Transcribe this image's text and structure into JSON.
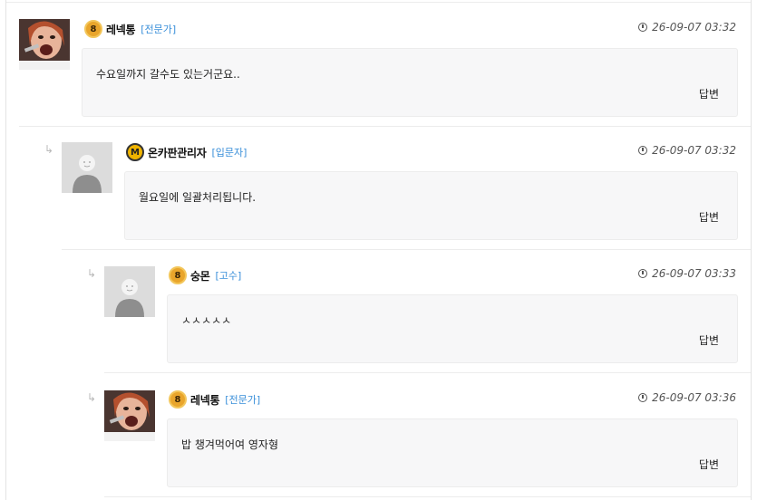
{
  "comments": [
    {
      "author": "레넥통",
      "badge": "8",
      "level": "[전문가]",
      "time": "26-09-07 03:32",
      "text": "수요일까지 갈수도 있는거군요..",
      "reply": "답변",
      "avatar": "photo-avatar"
    },
    {
      "author": "온카판관리자",
      "badge": "M",
      "level": "[입문자]",
      "time": "26-09-07 03:32",
      "text": "월요일에 일괄처리됩니다.",
      "reply": "답변",
      "avatar": "default-avatar"
    },
    {
      "author": "숭몬",
      "badge": "8",
      "level": "[고수]",
      "time": "26-09-07 03:33",
      "text": "ㅅㅅㅅㅅㅅ",
      "reply": "답변",
      "avatar": "default-avatar"
    },
    {
      "author": "레넥통",
      "badge": "8",
      "level": "[전문가]",
      "time": "26-09-07 03:36",
      "text": "밥 챙겨먹어여 영자형",
      "reply": "답변",
      "avatar": "photo-avatar"
    }
  ],
  "icons": {
    "clock": "clock-icon",
    "reply_arrow": "reply-arrow-icon",
    "level_badge": "level-badge-icon"
  },
  "colors": {
    "level_text": "#3a8fd9",
    "bubble_bg": "#f7f7f8",
    "badge_gold": "#e9a52b"
  }
}
